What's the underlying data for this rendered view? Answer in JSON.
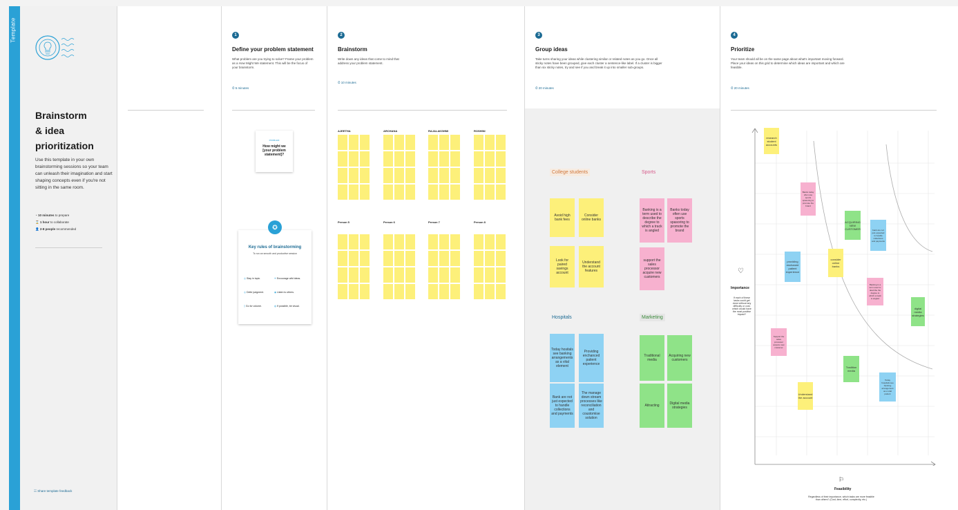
{
  "sidebar": {
    "tab_label": "Template"
  },
  "intro": {
    "title_line1": "Brainstorm",
    "title_line2": "& idea prioritization",
    "desc": "Use this template in your own brainstorming sessions so your team can unleash their imagination and start shaping concepts even if you're not sitting in the same room.",
    "meta": [
      {
        "bold": "10 minutes",
        "text": " to prepare"
      },
      {
        "bold": "1 hour",
        "text": " to collaborate"
      },
      {
        "bold": "2-8 people",
        "text": " recommended"
      }
    ],
    "feedback_label": "Share template feedback"
  },
  "step1": {
    "num": "1",
    "title": "Define your problem statement",
    "desc": "What problem are you trying to solve? Frame your problem as a How Might We statement. This will be the focus of your brainstorm.",
    "time": "5 minutes",
    "card_label": "PROBLEM",
    "card_text": "How might we [your problem statement]?",
    "rules_title": "Key rules of brainstorming",
    "rules_sub": "To run an smooth and productive session",
    "rules": [
      "Stay in topic.",
      "Encourage wild ideas.",
      "Defer judgment.",
      "Listen to others.",
      "Go for volume.",
      "If possible, be visual."
    ]
  },
  "step2": {
    "num": "2",
    "title": "Brainstorm",
    "desc": "Write down any ideas that come to mind that address your problem statement.",
    "time": "10 minutes",
    "people": [
      "AJEETHA",
      "ARCHANA",
      "RAJALAKSHMI",
      "ROSHINI",
      "Person 5",
      "Person 6",
      "Person 7",
      "Person 8"
    ]
  },
  "step3": {
    "num": "3",
    "title": "Group ideas",
    "desc": "Take turns sharing your ideas while clustering similar or related notes as you go. Once all sticky notes have been grouped, give each cluster a sentence-like label. If a cluster is bigger than six sticky notes, try and see if you and break it up into smaller sub-groups.",
    "time": "20 minutes",
    "groups": {
      "college": {
        "title": "College students",
        "notes": [
          "Avoid high bank fees",
          "Consider online banks",
          "Look for paired savings account",
          "Understand the account features"
        ]
      },
      "sports": {
        "title": "Sports",
        "notes": [
          "Banking is a term used to describe the degree to which a track is angled",
          "Banks today often use sports spasoring to promote the brand",
          "support the sales processor acquire new customers"
        ]
      },
      "hospitals": {
        "title": "Hospitals",
        "notes": [
          "Today hositals see banking arrangements as a vital element",
          "Providing enchanced patient experience",
          "Bank are not just expected to handle collections and payments",
          "The manage down stream processes like reconciliation and coustomise solution"
        ]
      },
      "marketing": {
        "title": "Marketing",
        "notes": [
          "Traditional media",
          "Acquiring new customers",
          "Attracting",
          "Digital media strategies"
        ]
      }
    }
  },
  "step4": {
    "num": "4",
    "title": "Prioritize",
    "desc": "Your team should all be on the same page about what's important moving forward. Place your ideas on this grid to determine which ideas are important and which are feasible.",
    "time": "20 minutes",
    "importance_label": "Importance",
    "importance_desc": "If each of these tasks could get done without any difficulty or cost, which would have the most positive impact?",
    "feasibility_label": "Feasibility",
    "feasibility_desc": "Regardless of their importance, which tasks are more feasible than others? (Cost, time, effort, complexity, etc.)",
    "notes": [
      "research student accounts",
      "Banks today often use sports spasoring to promote the brand",
      "ACQUIRING NEW CUSTOMER",
      "bank are not just expected to handle collections and payments",
      "providing enchaned patient experience",
      "consider online banks",
      "Banking is a term used to describe the degree to which a track is angled",
      "digital media strategies",
      "Support the sales processor acquire new customer",
      "Tradition media",
      "Today hospitals see banking arrangement as a vital patient",
      "Understand the account"
    ]
  },
  "colors": {
    "accent": "#2aa1d6",
    "yellow": "#fdf07a",
    "pink": "#f7b1cf",
    "blue": "#8ed2f3",
    "green": "#8fe388"
  }
}
